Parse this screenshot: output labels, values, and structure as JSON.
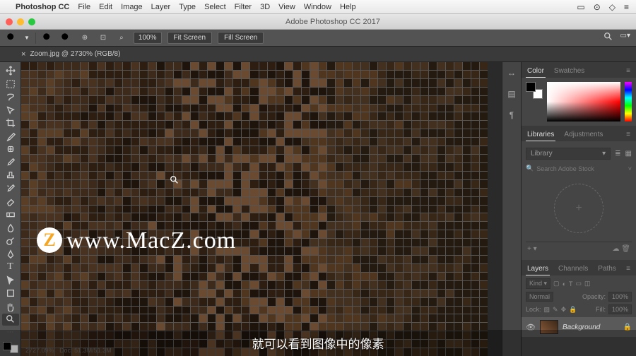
{
  "mac_menu": {
    "app": "Photoshop CC",
    "items": [
      "File",
      "Edit",
      "Image",
      "Layer",
      "Type",
      "Select",
      "Filter",
      "3D",
      "View",
      "Window",
      "Help"
    ]
  },
  "window": {
    "title": "Adobe Photoshop CC 2017"
  },
  "options": {
    "zoom_pct": "100%",
    "fit_screen": "Fit Screen",
    "fill_screen": "Fill Screen"
  },
  "tab": {
    "label": "Zoom.jpg @ 2730% (RGB/8)"
  },
  "watermark": {
    "logo": "Z",
    "text": "www.MacZ.com"
  },
  "panels": {
    "color_tab": "Color",
    "swatches_tab": "Swatches",
    "libraries_tab": "Libraries",
    "adjustments_tab": "Adjustments",
    "library_label": "Library",
    "search_placeholder": "Search Adobe Stock",
    "add_icon": "+",
    "layers_tab": "Layers",
    "channels_tab": "Channels",
    "paths_tab": "Paths",
    "kind_label": "Kind",
    "blend_mode": "Normal",
    "opacity_label": "Opacity:",
    "opacity_val": "100%",
    "lock_label": "Lock:",
    "fill_label": "Fill:",
    "fill_val": "100%",
    "layer_name": "Background"
  },
  "status": {
    "left": "2727.09%",
    "doc": "Doc: 51.3M/51.3M"
  },
  "subtitle": "就可以看到图像中的像素"
}
